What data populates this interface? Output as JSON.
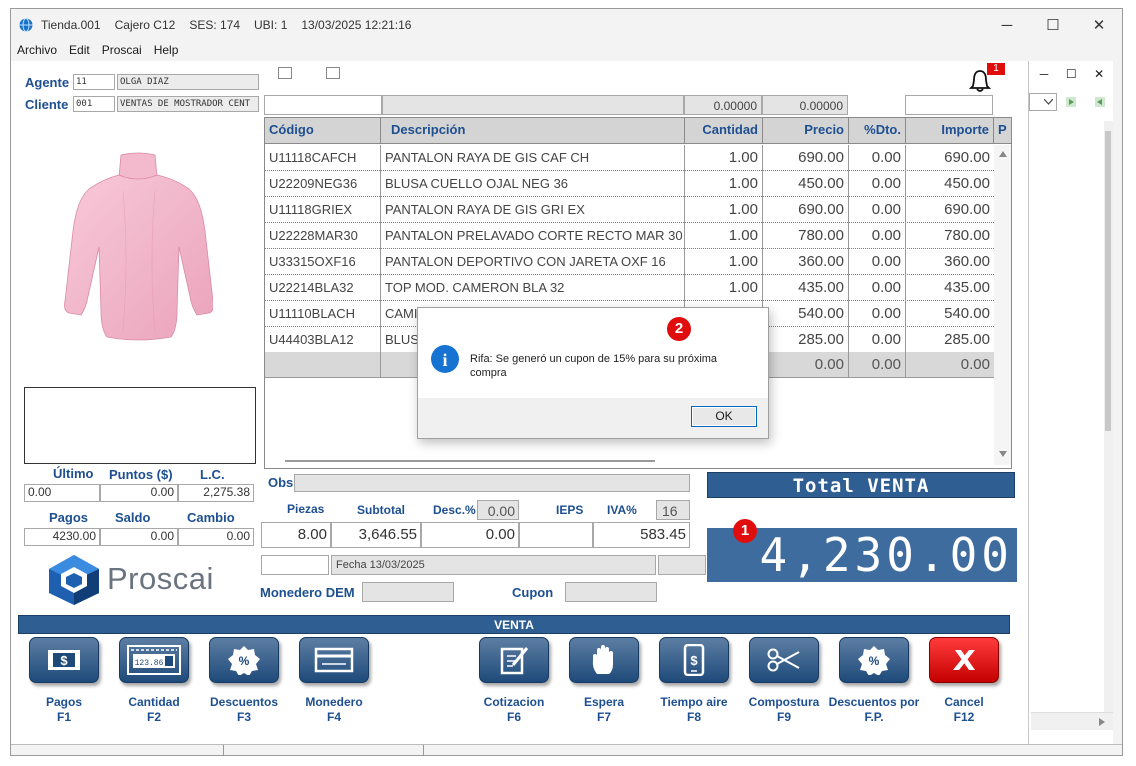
{
  "window": {
    "title_parts": [
      "Tienda.001",
      "Cajero C12",
      "SES: 174",
      "UBI: 1",
      "13/03/2025 12:21:16"
    ],
    "minimize": "─",
    "maximize": "☐",
    "close": "✕",
    "child_minimize": "─",
    "child_maximize": "☐",
    "child_close": "✕"
  },
  "menu": [
    "Archivo",
    "Edit",
    "Proscai",
    "Help"
  ],
  "agente": {
    "label": "Agente",
    "code": "11",
    "name": "OLGA DIAZ"
  },
  "cliente": {
    "label": "Cliente",
    "code": "001",
    "name": "VENTAS DE MOSTRADOR CENT"
  },
  "top_values": {
    "v1": "0.00000",
    "v2": "0.00000"
  },
  "notification_count": "1",
  "grid": {
    "headers": [
      "Código",
      "Descripción",
      "Cantidad",
      "Precio",
      "%Dto.",
      "Importe",
      "P"
    ],
    "rows": [
      [
        "U11118CAFCH",
        "PANTALON RAYA DE GIS CAF CH",
        "1.00",
        "690.00",
        "0.00",
        "690.00"
      ],
      [
        "U22209NEG36",
        "BLUSA CUELLO OJAL NEG 36",
        "1.00",
        "450.00",
        "0.00",
        "450.00"
      ],
      [
        "U11118GRIEX",
        "PANTALON RAYA DE GIS GRI EX",
        "1.00",
        "690.00",
        "0.00",
        "690.00"
      ],
      [
        "U22228MAR30",
        "PANTALON PRELAVADO CORTE RECTO MAR 30",
        "1.00",
        "780.00",
        "0.00",
        "780.00"
      ],
      [
        "U33315OXF16",
        "PANTALON  DEPORTIVO CON JARETA OXF 16",
        "1.00",
        "360.00",
        "0.00",
        "360.00"
      ],
      [
        "U22214BLA32",
        "TOP MOD. CAMERON BLA 32",
        "1.00",
        "435.00",
        "0.00",
        "435.00"
      ],
      [
        "U11110BLACH",
        "CAMIS",
        "",
        "540.00",
        "0.00",
        "540.00"
      ],
      [
        "U44403BLA12",
        "BLUSA",
        "",
        "285.00",
        "0.00",
        "285.00"
      ]
    ],
    "footer": {
      "precio": "0.00",
      "dto": "0.00",
      "importe": "0.00"
    }
  },
  "stats": {
    "headers1": [
      "Último",
      "Puntos ($)",
      "L.C."
    ],
    "values1": [
      "0.00",
      "0.00",
      "2,275.38"
    ],
    "headers2": [
      "Pagos",
      "Saldo",
      "Cambio"
    ],
    "values2": [
      "4230.00",
      "0.00",
      "0.00"
    ]
  },
  "brand": "Proscai",
  "obs_label": "Obs",
  "totals": {
    "headers": [
      "Piezas",
      "Subtotal",
      "Desc.%",
      "IEPS",
      "IVA%"
    ],
    "desc_pct": "0.00",
    "iva_pct": "16",
    "piezas": "8.00",
    "subtotal": "3,646.55",
    "desc": "0.00",
    "ieps": "",
    "iva": "583.45"
  },
  "fecha": "Fecha 13/03/2025",
  "monedero_label": "Monedero DEM",
  "cupon_label": "Cupon",
  "total_venta_label": "Total VENTA",
  "total_venta_value": "4,230.00",
  "mode_label": "VENTA",
  "fn_buttons": [
    {
      "name": "pagos",
      "label": "Pagos",
      "key": "F1",
      "icon": "$"
    },
    {
      "name": "cantidad",
      "label": "Cantidad",
      "key": "F2",
      "icon": "123.86"
    },
    {
      "name": "descuentos",
      "label": "Descuentos",
      "key": "F3",
      "icon": "%"
    },
    {
      "name": "monedero",
      "label": "Monedero",
      "key": "F4",
      "icon": ""
    },
    {
      "name": "cotizacion",
      "label": "Cotizacion",
      "key": "F6",
      "icon": ""
    },
    {
      "name": "espera",
      "label": "Espera",
      "key": "F7",
      "icon": ""
    },
    {
      "name": "tiempo-aire",
      "label": "Tiempo aire",
      "key": "F8",
      "icon": "$"
    },
    {
      "name": "compostura",
      "label": "Compostura",
      "key": "F9",
      "icon": ""
    },
    {
      "name": "descuentos-fp",
      "label": "Descuentos por",
      "key": "F.P.",
      "icon": "%"
    },
    {
      "name": "cancel",
      "label": "Cancel",
      "key": "F12",
      "icon": "✕"
    }
  ],
  "dialog": {
    "message": "Rifa: Se generó un cupon de 15% para su próxima compra",
    "ok": "OK",
    "info_glyph": "i"
  },
  "badges": {
    "total": "1",
    "dialog": "2"
  }
}
